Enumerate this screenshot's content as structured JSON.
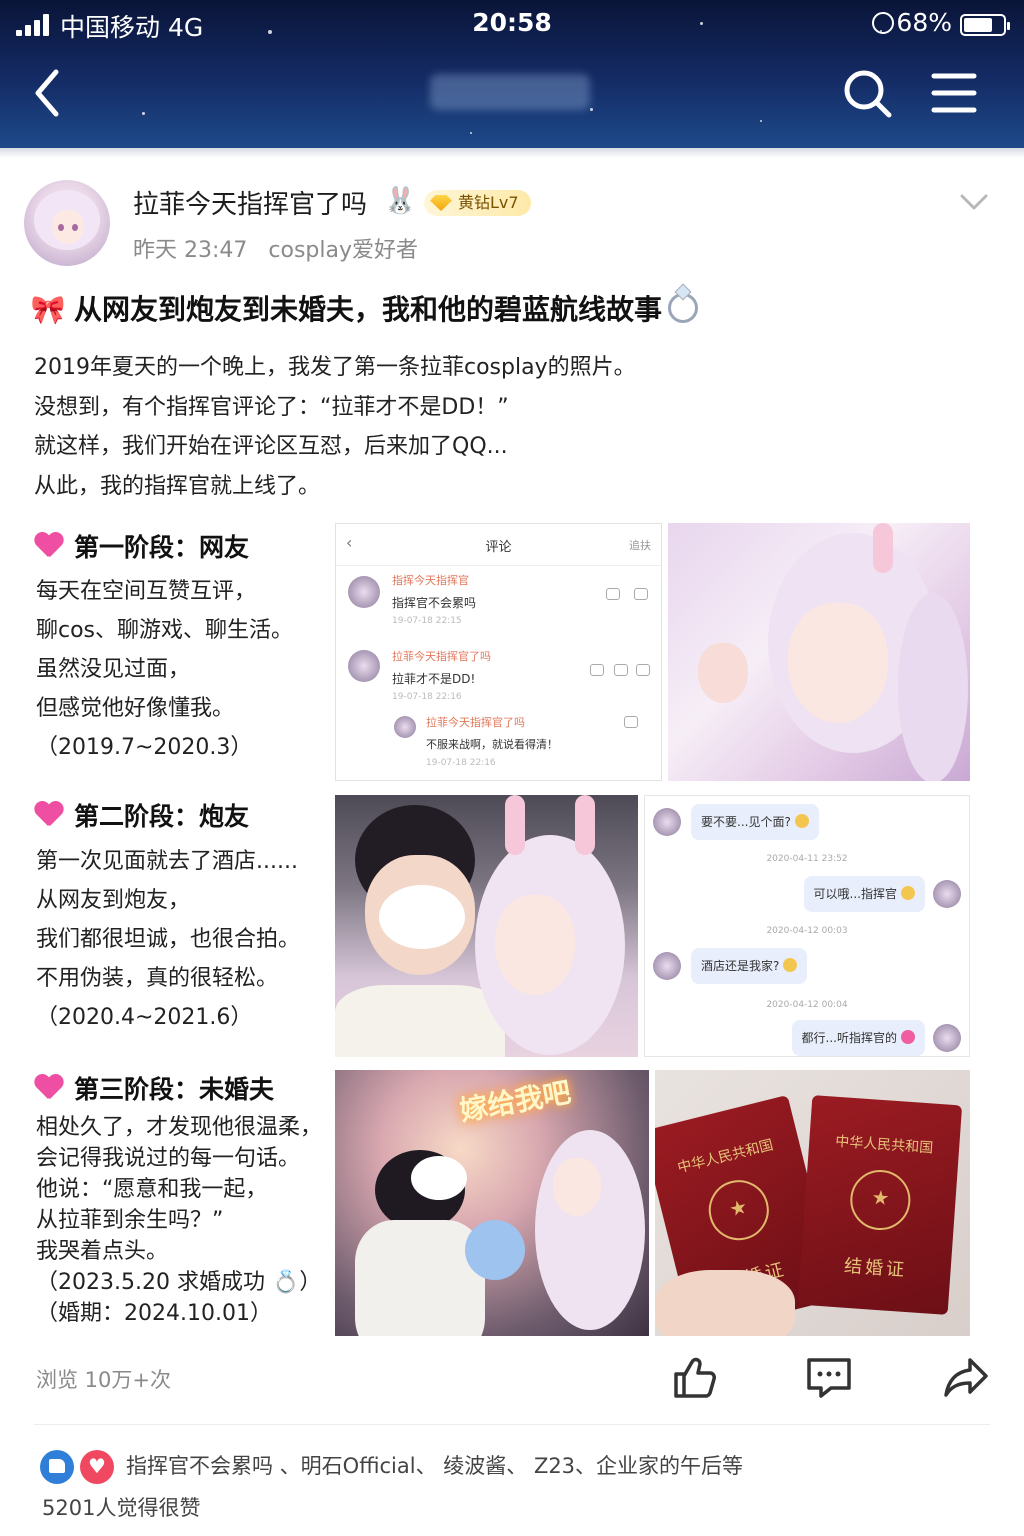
{
  "status": {
    "carrier": "中国移动  4G",
    "time": "20:58",
    "battery": "68%"
  },
  "nav": {
    "back_icon": "chevron-left-icon",
    "search_icon": "search-icon",
    "menu_icon": "hamburger-menu-icon"
  },
  "author": {
    "name": "拉菲今天指挥官了吗",
    "badge": "黄钻Lv7",
    "time": "昨天 23:47",
    "tag": "cosplay爱好者"
  },
  "post": {
    "title": "从网友到炮友到未婚夫，我和他的碧蓝航线故事",
    "intro": [
      "2019年夏天的一个晚上，我发了第一条拉菲cosplay的照片。",
      "没想到，有个指挥官评论了：“拉菲才不是DD！”",
      "就这样，我们开始在评论区互怼，后来加了QQ...",
      "从此，我的指挥官就上线了。"
    ],
    "stages": [
      {
        "title": "第一阶段：网友",
        "lines": [
          "每天在空间互赞互评，",
          "聊cos、聊游戏、聊生活。",
          "虽然没见过面，",
          "但感觉他好像懂我。",
          "（2019.7~2020.3）"
        ]
      },
      {
        "title": "第二阶段：炮友",
        "lines": [
          "第一次见面就去了酒店......",
          "从网友到炮友，",
          "我们都很坦诚，也很合拍。",
          "不用伪装，真的很轻松。",
          "（2020.4~2021.6）"
        ]
      },
      {
        "title": "第三阶段：未婚夫",
        "lines": [
          "相处久了，才发现他很温柔，",
          "会记得我说过的每一句话。",
          "他说：“愿意和我一起，",
          "从拉菲到余生吗？”",
          "我哭着点头。",
          "（2023.5.20 求婚成功 💍）",
          "（婚期：2024.10.01）"
        ]
      }
    ]
  },
  "screenshot_comments": {
    "header": "评论",
    "header_right": "追扶",
    "comments": [
      {
        "name": "指挥今天指挥官",
        "text": "指挥官不会累吗",
        "date": "19-07-18 22:15"
      },
      {
        "name": "拉菲今天指挥官了吗",
        "text": "拉菲才不是DD!",
        "date": "19-07-18 22:16"
      },
      {
        "name": "拉菲今天指挥官了吗",
        "text": "不服来战啊，就说看得清！",
        "date": "19-07-18 22:16"
      }
    ]
  },
  "screenshot_chat": {
    "messages": [
      {
        "text": "要不要...见个面?",
        "side": "left"
      },
      {
        "time": "2020-04-11 23:52"
      },
      {
        "text": "可以哦...指挥官",
        "side": "right"
      },
      {
        "time": "2020-04-12 00:03"
      },
      {
        "text": "酒店还是我家?",
        "side": "left"
      },
      {
        "time": "2020-04-12 00:04"
      },
      {
        "text": "都行...听指挥官的",
        "side": "right"
      }
    ]
  },
  "proposal_banner": "嫁给我吧",
  "marriage_certificate": {
    "country": "中华人民共和国",
    "label": "结婚证"
  },
  "footer": {
    "views": "浏览 10万+次",
    "likers": "指挥官不会累吗 、明石Official、 绫波酱、 Z23、企业家的午后等",
    "like_count": "5201人觉得很赞"
  }
}
